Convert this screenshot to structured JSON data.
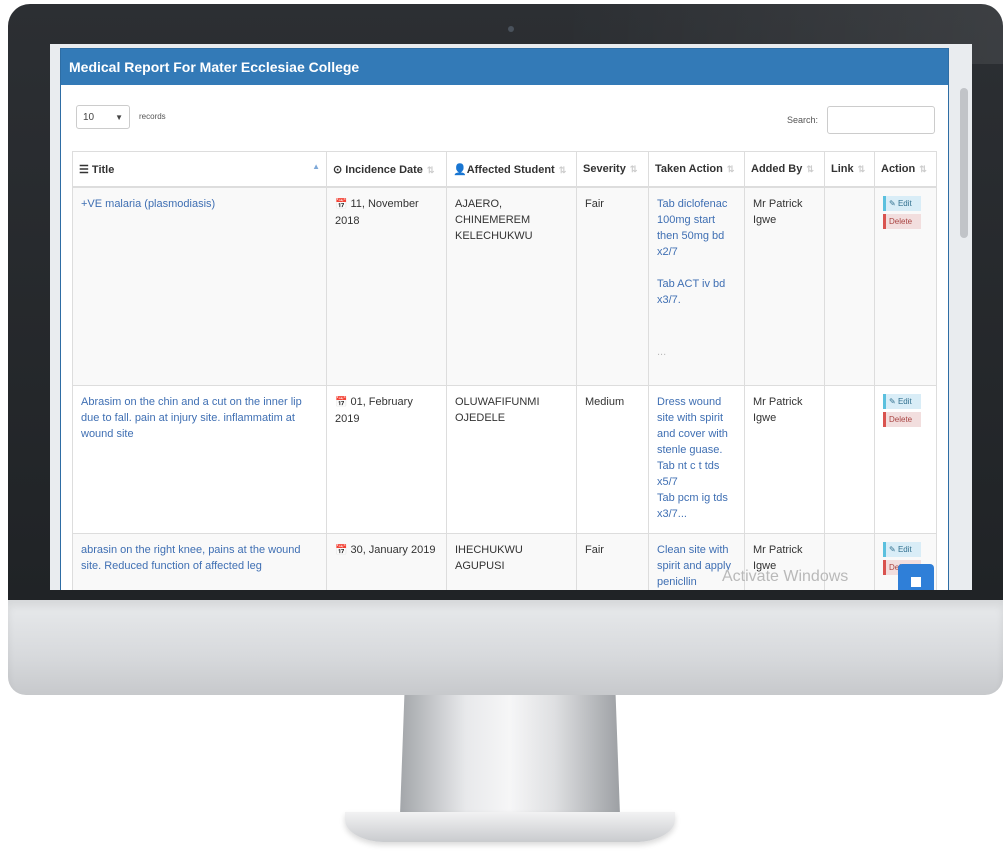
{
  "panel": {
    "title": "Medical Report For Mater Ecclesiae College"
  },
  "controls": {
    "length_value": "10",
    "length_label": "records",
    "search_label": "Search:",
    "search_value": ""
  },
  "table": {
    "headers": [
      "Title",
      "Incidence Date",
      "Affected Student",
      "Severity",
      "Taken Action",
      "Added By",
      "Link",
      "Action"
    ],
    "rows": [
      {
        "title": "+VE malaria (plasmodiasis)",
        "date": "11, November 2018",
        "student": "AJAERO, CHINEMEREM KELECHUKWU",
        "severity": "Fair",
        "action_text_1": "Tab diclofenac 100mg start then 50mg bd x2/7",
        "action_text_2": "Tab ACT iv bd x3/7.",
        "action_text_3": "...",
        "added_by": "Mr Patrick Igwe",
        "link": "",
        "edit_label": "Edit",
        "delete_label": "Delete"
      },
      {
        "title": "Abrasim on the chin and a cut on the inner lip due to fall. pain at injury site. inflammatim at wound site",
        "date": "01, February 2019",
        "student": "OLUWAFIFUNMI OJEDELE",
        "severity": "Medium",
        "action_text_1": "Dress wound site with spirit and cover with stenle guase. Tab nt c t tds x5/7",
        "action_text_2": "Tab pcm ig tds x3/7...",
        "added_by": "Mr Patrick Igwe",
        "link": "",
        "edit_label": "Edit",
        "delete_label": "Delete"
      },
      {
        "title": "abrasin on the right knee, pains at the wound site. Reduced function of affected leg",
        "date": "30, January 2019",
        "student": "IHECHUKWU AGUPUSI",
        "severity": "Fair",
        "action_text_1": "Clean site with spirit and apply penicllin",
        "added_by": "Mr Patrick Igwe",
        "link": "",
        "edit_label": "Edit",
        "delete_label": "Delete"
      }
    ]
  },
  "overlay": {
    "watermark": "Activate Windows"
  },
  "colors": {
    "accent": "#337ab7",
    "link_text": "#3f6fb3"
  }
}
